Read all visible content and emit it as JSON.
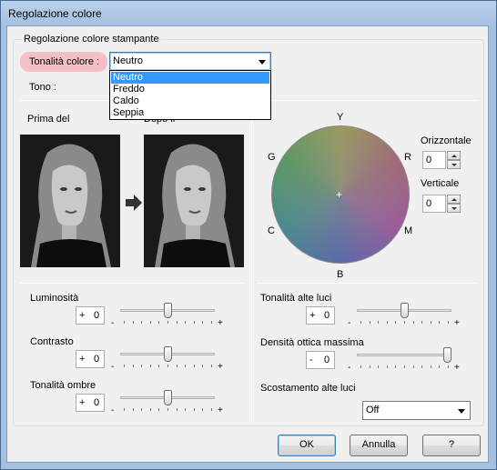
{
  "window": {
    "title": "Regolazione colore"
  },
  "group_printer": {
    "legend": "Regolazione colore stampante"
  },
  "tone": {
    "label_prefix": "Tonalità colore",
    "label_accel": "l",
    "label": "Tonalità colore :",
    "value": "Neutro",
    "options": [
      "Neutro",
      "Freddo",
      "Caldo",
      "Seppia"
    ],
    "selected_index": 0
  },
  "tono": {
    "label": "Tono :"
  },
  "preview": {
    "before_label": "Prima del",
    "after_label": "Dopo il"
  },
  "color_wheel": {
    "labels": {
      "top": "Y",
      "bottom": "B",
      "left_top": "G",
      "right_top": "R",
      "left_bottom": "C",
      "right_bottom": "M"
    },
    "horizontal_label": "Orizzontale",
    "horizontal_value": "0",
    "vertical_label": "Verticale",
    "vertical_value": "0"
  },
  "adjust_left": [
    {
      "label": "Luminosità",
      "sign": "+",
      "value": "0",
      "min": "-",
      "max": "+",
      "level": 0.5
    },
    {
      "label": "Contrasto",
      "sign": "+",
      "value": "0",
      "min": "-",
      "max": "+",
      "level": 0.5
    },
    {
      "label": "Tonalità ombre",
      "sign": "+",
      "value": "0",
      "min": "-",
      "max": "+",
      "level": 0.5
    }
  ],
  "adjust_right": [
    {
      "label": "Tonalità alte luci",
      "sign": "+",
      "value": "0",
      "min": "-",
      "max": "+",
      "level": 0.5
    },
    {
      "label": "Densità ottica massima",
      "sign": "-",
      "value": "0",
      "min": "-",
      "max": "+",
      "level": 1.0
    }
  ],
  "highlight_offset": {
    "label": "Scostamento alte luci",
    "value": "Off"
  },
  "buttons": {
    "ok": "OK",
    "cancel": "Annulla",
    "help": "?"
  }
}
